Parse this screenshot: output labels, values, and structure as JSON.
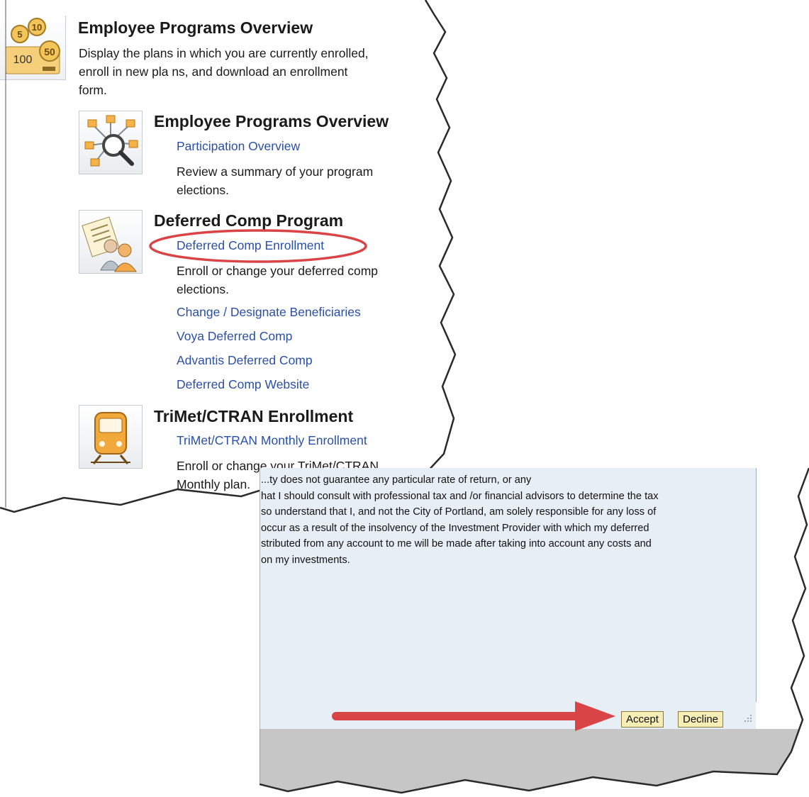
{
  "top_panel": {
    "header_title": "Employee Programs Overview",
    "header_desc_lines": [
      "Display the plans in which you are currently enrolled,",
      "enroll in new pla ns, and download an enrollment",
      "form."
    ],
    "coin_labels": [
      "5",
      "10",
      "100",
      "50"
    ],
    "sections": [
      {
        "title": "Employee Programs Overview",
        "links": [
          {
            "label": "Participation Overview"
          }
        ],
        "desc_lines": [
          "Review a summary of your program",
          "elections."
        ]
      },
      {
        "title": "Deferred Comp Program",
        "links": [
          {
            "label": "Deferred Comp Enrollment"
          },
          {
            "label": "Change / Designate Beneficiaries"
          },
          {
            "label": "Voya Deferred Comp"
          },
          {
            "label": "Advantis Deferred Comp"
          },
          {
            "label": "Deferred Comp Website"
          }
        ],
        "desc_lines": [
          "Enroll or change your deferred comp",
          "elections."
        ]
      },
      {
        "title": "TriMet/CTRAN Enrollment",
        "links": [
          {
            "label": "TriMet/CTRAN Monthly Enrollment"
          }
        ],
        "desc_lines": [
          "Enroll or change your TriMet/CTRAN",
          "Monthly plan."
        ]
      }
    ]
  },
  "dialog": {
    "legal_lines": [
      "...ty does not guarantee any particular rate of return, or any",
      "hat I should consult with professional tax and /or financial advisors to determine the tax",
      "so understand that I, and not the City of Portland, am solely responsible for any loss of",
      "occur as a result of the insolvency of the Investment Provider with which my deferred",
      "stributed from any account to me will be made after taking into account any costs and",
      "on my investments."
    ],
    "accept_label": "Accept",
    "decline_label": "Decline"
  },
  "colors": {
    "link": "#2a4fa7",
    "highlight_circle": "#d94446",
    "arrow": "#d94446",
    "button_fill": "#f7eeb6",
    "dialog_bg": "#e8eef5"
  },
  "icons": [
    "coins-icon",
    "network-search-icon",
    "document-people-icon",
    "train-icon",
    "resize-grip-icon"
  ]
}
